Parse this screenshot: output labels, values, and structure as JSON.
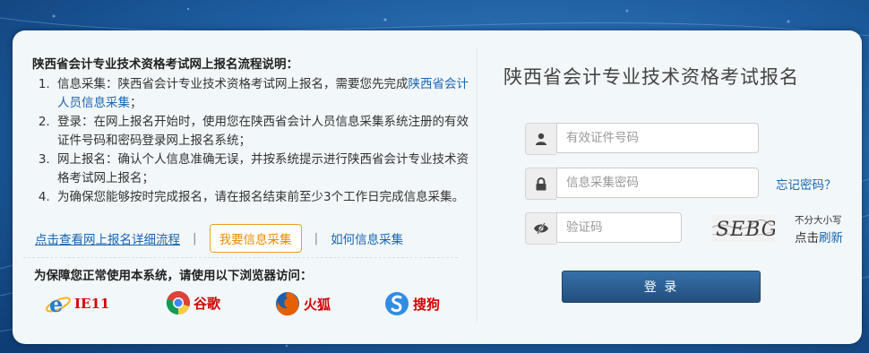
{
  "instructions": {
    "title": "陕西省会计专业技术资格考试网上报名流程说明：",
    "steps": [
      {
        "text": "信息采集：陕西省会计专业技术资格考试网上报名，需要您先完成",
        "link": "陕西省会计人员信息采集",
        "after": "；"
      },
      {
        "text": "登录：在网上报名开始时，使用您在陕西省会计人员信息采集系统注册的有效证件号码和密码登录网上报名系统；"
      },
      {
        "text": "网上报名：确认个人信息准确无误，并按系统提示进行陕西省会计专业技术资格考试网上报名；"
      },
      {
        "text": "为确保您能够按时完成报名，请在报名结束前至少3个工作日完成信息采集。"
      }
    ]
  },
  "links": {
    "detail_flow": "点击查看网上报名详细流程",
    "separator": "|",
    "collect_button": "我要信息采集",
    "how_collect": "如何信息采集"
  },
  "browsers": {
    "title": "为保障您正常使用本系统，请使用以下浏览器访问：",
    "items": [
      {
        "name": "IE11",
        "icon": "ie-icon"
      },
      {
        "name": "谷歌",
        "icon": "chrome-icon"
      },
      {
        "name": "火狐",
        "icon": "firefox-icon"
      },
      {
        "name": "搜狗",
        "icon": "sogou-icon"
      }
    ]
  },
  "form": {
    "title": "陕西省会计专业技术资格考试报名",
    "id_placeholder": "有效证件号码",
    "password_placeholder": "信息采集密码",
    "forgot_password": "忘记密码？",
    "captcha_placeholder": "验证码",
    "captcha_text": "SEBG",
    "case_note": "不分大小写",
    "refresh_prefix": "点击",
    "refresh_link": "刷新",
    "login_label": "登 录"
  },
  "colors": {
    "link": "#1a66b0",
    "collect_button_border": "#f0a020",
    "browser_name": "#d40000",
    "login_button": "#2c5f94"
  }
}
